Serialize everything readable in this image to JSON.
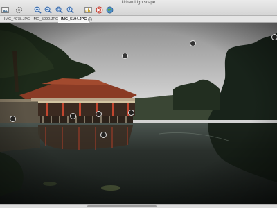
{
  "window": {
    "title": "Urban Lightscape"
  },
  "toolbar": {
    "buttons": [
      {
        "icon": "image-icon",
        "tooltip": ""
      },
      {
        "icon": "settings-icon",
        "tooltip": ""
      },
      {
        "icon": "zoom-in-icon",
        "tooltip": ""
      },
      {
        "icon": "zoom-out-icon",
        "tooltip": ""
      },
      {
        "icon": "zoom-fit-icon",
        "tooltip": ""
      },
      {
        "icon": "zoom-actual-icon",
        "tooltip": ""
      },
      {
        "icon": "histogram-icon",
        "tooltip": ""
      },
      {
        "icon": "target-icon",
        "tooltip": ""
      },
      {
        "icon": "globe-icon",
        "tooltip": ""
      }
    ]
  },
  "tabs": [
    {
      "label": "IMG_4978.JPG",
      "active": false
    },
    {
      "label": "IMG_5090.JPG",
      "active": false
    },
    {
      "label": "IMG_5194.JPG",
      "active": true,
      "close": "×"
    }
  ],
  "photo": {
    "markers": [
      "",
      "",
      "",
      "",
      "",
      "",
      "",
      ""
    ]
  },
  "colors": {
    "sky": "#cfcfcf",
    "water": "#1f2622",
    "roof": "#8a3b25",
    "foliage": "#1d2a1a"
  }
}
